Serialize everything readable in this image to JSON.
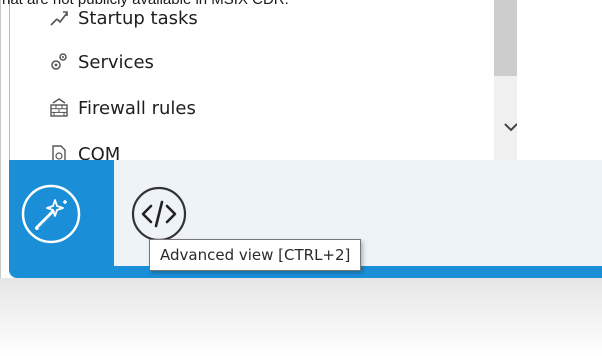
{
  "caption": "hat are not publicly available in MSIX CDR.",
  "list": {
    "items": [
      {
        "label": "Startup tasks",
        "icon": "startup-tasks-icon"
      },
      {
        "label": "Services",
        "icon": "services-icon"
      },
      {
        "label": "Firewall rules",
        "icon": "firewall-icon"
      },
      {
        "label": "COM",
        "icon": "com-icon"
      }
    ]
  },
  "mode_bar": {
    "wizard_icon": "magic-wand-icon",
    "advanced_icon": "code-brackets-icon",
    "tooltip": "Advanced view [CTRL+2]"
  },
  "colors": {
    "accent": "#1a8fd8",
    "bar_background": "#eef3f8",
    "scrollbar_track": "#f0f0f0",
    "scrollbar_thumb": "#cdcdcd"
  }
}
